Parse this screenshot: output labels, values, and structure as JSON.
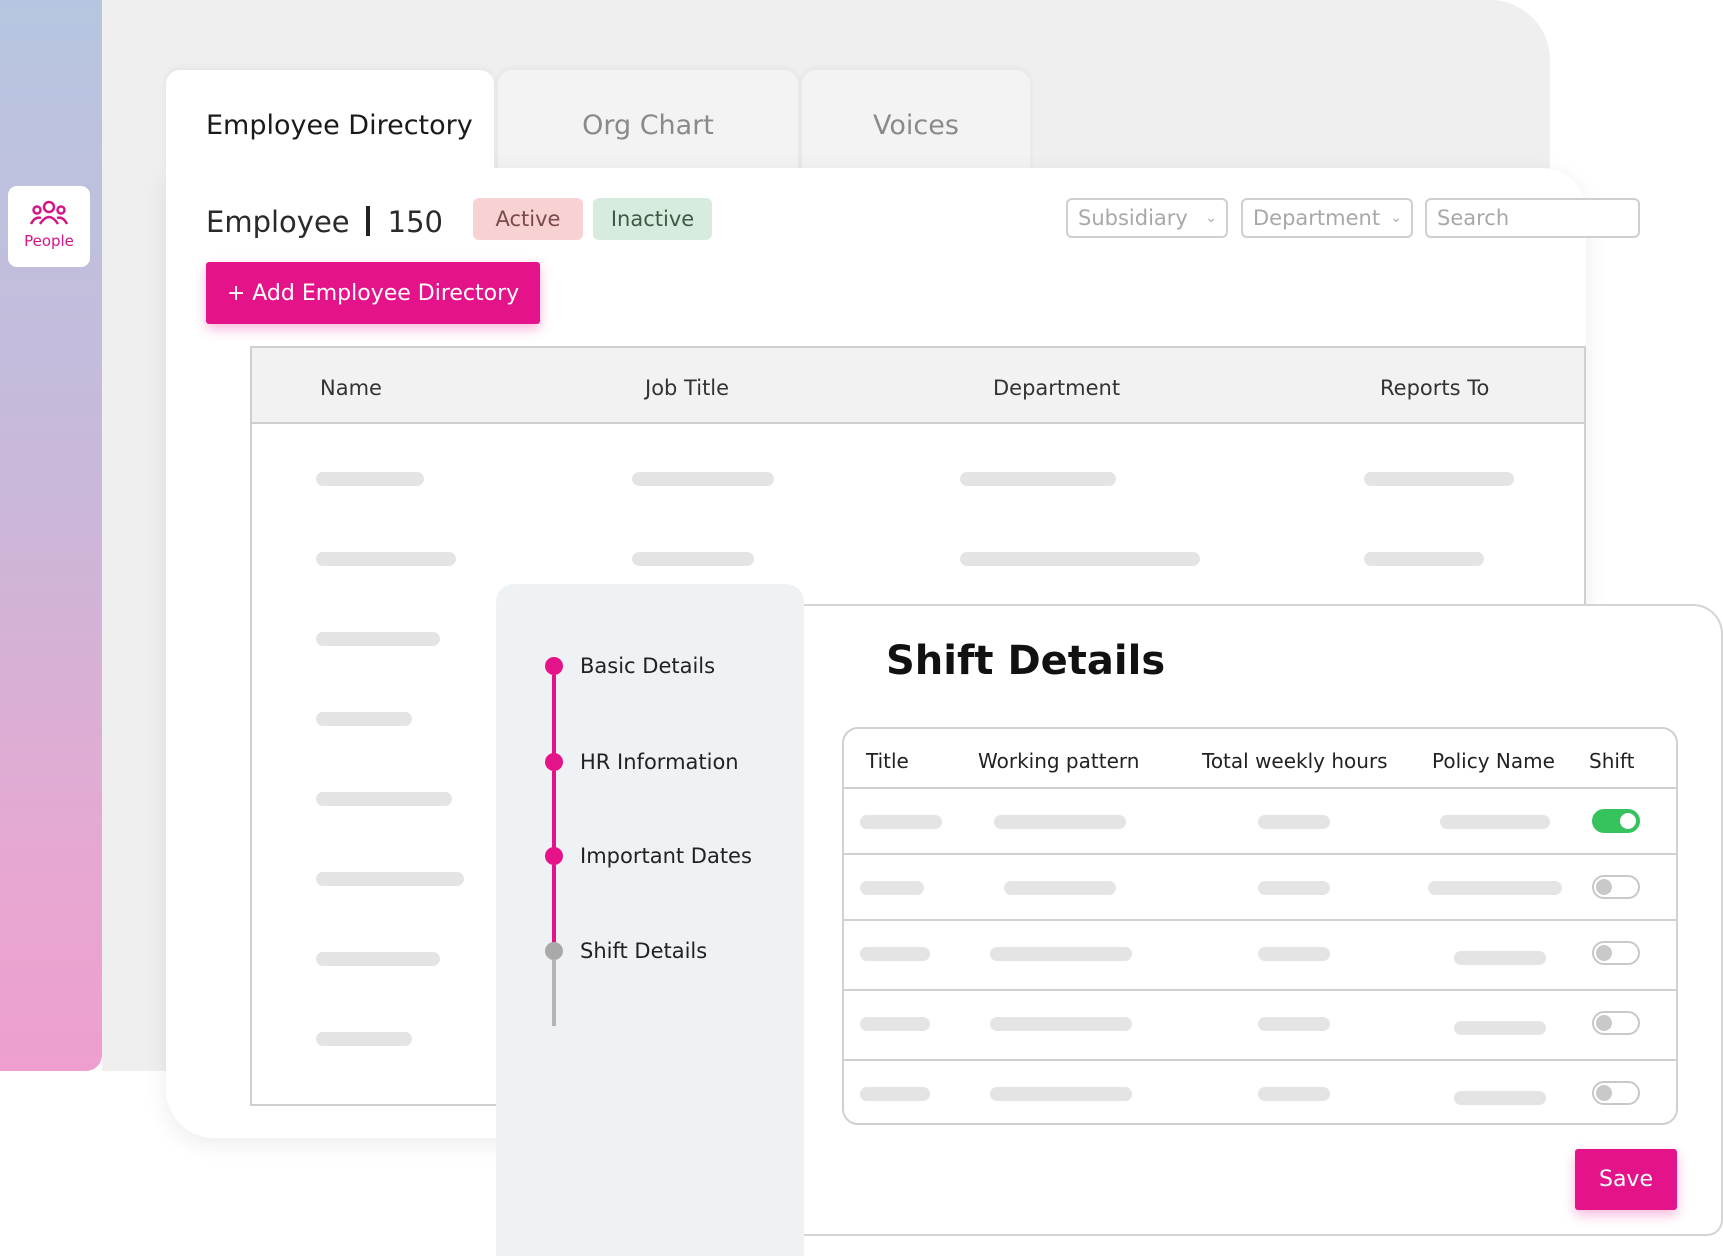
{
  "sidebar": {
    "items": [
      {
        "label": "People",
        "icon": "people-icon"
      }
    ]
  },
  "tabs": [
    {
      "label": "Employee Directory",
      "active": true
    },
    {
      "label": "Org Chart",
      "active": false
    },
    {
      "label": "Voices",
      "active": false
    }
  ],
  "directory": {
    "title": "Employee",
    "count": "150",
    "filters": {
      "active_label": "Active",
      "inactive_label": "Inactive"
    },
    "add_button_label": "+ Add Employee Directory",
    "subsidiary_select": "Subsidiary",
    "department_select": "Department",
    "search_placeholder": "Search",
    "columns": [
      "Name",
      "Job Title",
      "Department",
      "Reports To"
    ]
  },
  "steps": [
    {
      "label": "Basic Details",
      "status": "done"
    },
    {
      "label": "HR Information",
      "status": "done"
    },
    {
      "label": "Important Dates",
      "status": "done"
    },
    {
      "label": "Shift Details",
      "status": "current"
    }
  ],
  "shift": {
    "title": "Shift Details",
    "columns": [
      "Title",
      "Working pattern",
      "Total weekly hours",
      "Policy Name",
      "Shift"
    ],
    "rows": [
      {
        "shift_on": true
      },
      {
        "shift_on": false
      },
      {
        "shift_on": false
      },
      {
        "shift_on": false
      },
      {
        "shift_on": false
      }
    ],
    "save_label": "Save"
  },
  "colors": {
    "accent": "#e5138a",
    "toggle_on": "#36c25c",
    "active_chip": "#f8d1d3",
    "inactive_chip": "#d7ecdf"
  }
}
